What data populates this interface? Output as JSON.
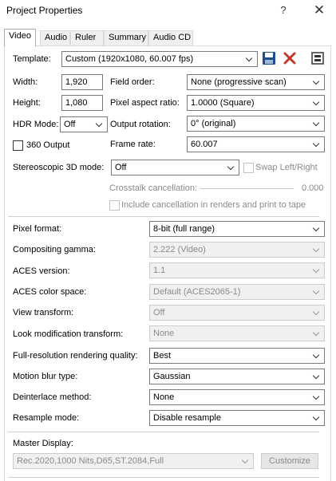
{
  "window": {
    "title": "Project Properties",
    "help": "?",
    "close": "✕"
  },
  "tabs": [
    "Video",
    "Audio",
    "Ruler",
    "Summary",
    "Audio CD"
  ],
  "template": {
    "label": "Template:",
    "value": "Custom (1920x1080, 60.007 fps)"
  },
  "width": {
    "label": "Width:",
    "value": "1,920"
  },
  "height": {
    "label": "Height:",
    "value": "1,080"
  },
  "field_order": {
    "label": "Field order:",
    "value": "None (progressive scan)"
  },
  "pixel_aspect": {
    "label": "Pixel aspect ratio:",
    "value": "1.0000 (Square)"
  },
  "hdr_mode": {
    "label": "HDR Mode:",
    "value": "Off"
  },
  "output_rotation": {
    "label": "Output rotation:",
    "value": "0° (original)"
  },
  "output_360": {
    "label": "360 Output"
  },
  "frame_rate": {
    "label": "Frame rate:",
    "value": "60.007"
  },
  "stereo_3d": {
    "label": "Stereoscopic 3D mode:",
    "value": "Off"
  },
  "swap_lr": {
    "label": "Swap Left/Right"
  },
  "crosstalk": {
    "label": "Crosstalk cancellation:",
    "value": "0.000"
  },
  "include_cancel": {
    "label": "Include cancellation in renders and print to tape"
  },
  "pixel_format": {
    "label": "Pixel format:",
    "value": "8-bit (full range)"
  },
  "compositing_gamma": {
    "label": "Compositing gamma:",
    "value": "2.222 (Video)"
  },
  "aces_version": {
    "label": "ACES version:",
    "value": "1.1"
  },
  "aces_color_space": {
    "label": "ACES color space:",
    "value": "Default (ACES2065-1)"
  },
  "view_transform": {
    "label": "View transform:",
    "value": "Off"
  },
  "look_mod": {
    "label": "Look modification transform:",
    "value": "None"
  },
  "render_quality": {
    "label": "Full-resolution rendering quality:",
    "value": "Best"
  },
  "motion_blur": {
    "label": "Motion blur type:",
    "value": "Gaussian"
  },
  "deinterlace": {
    "label": "Deinterlace method:",
    "value": "None"
  },
  "resample": {
    "label": "Resample mode:",
    "value": "Disable resample"
  },
  "master_display": {
    "label": "Master Display:",
    "value": "Rec.2020,1000 Nits,D65,ST.2084,Full",
    "customize": "Customize"
  },
  "colors": {
    "save_icon": "#1f4e8c",
    "delete_icon": "#c0392b",
    "disabled_text": "#8a8a8a"
  }
}
